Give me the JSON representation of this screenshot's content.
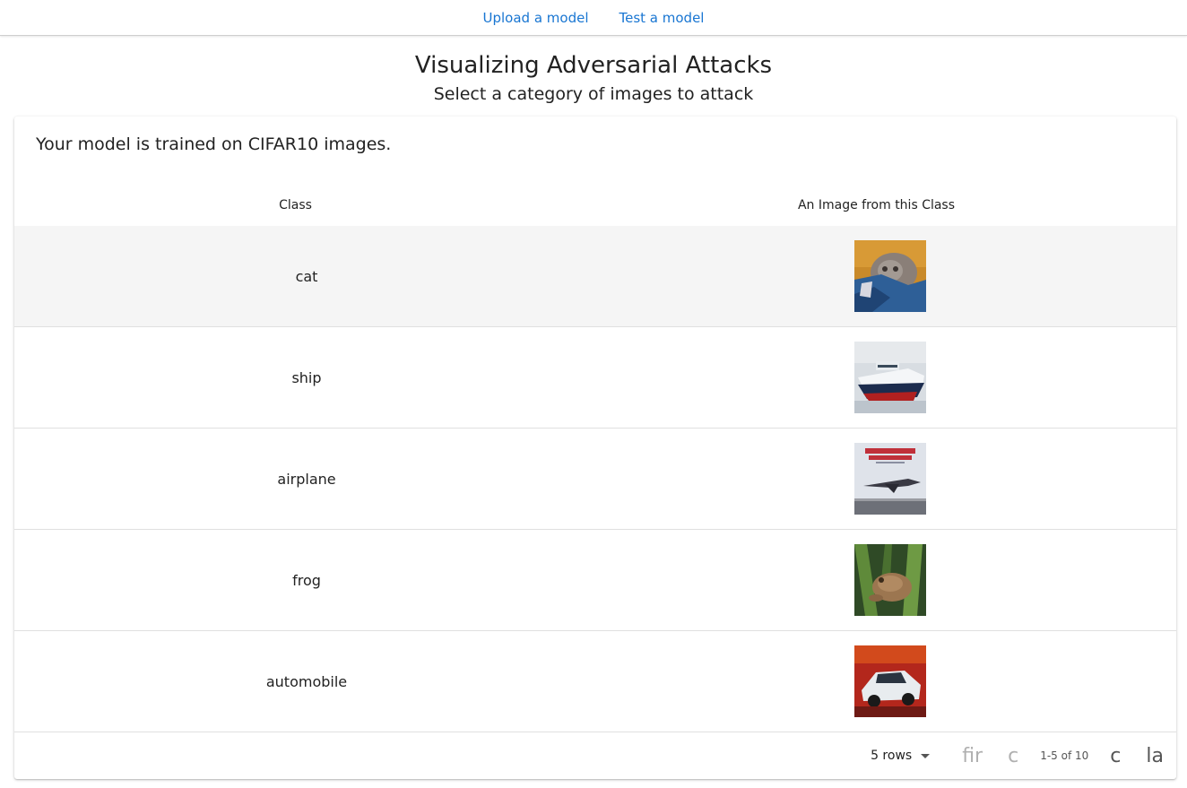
{
  "nav": {
    "links": [
      "Upload a model",
      "Test a model"
    ]
  },
  "page": {
    "title": "Visualizing Adversarial Attacks",
    "subtitle": "Select a category of images to attack"
  },
  "card": {
    "heading": "Your model is trained on CIFAR10 images.",
    "columns": [
      "Class",
      "An Image from this Class"
    ],
    "rows": [
      {
        "class": "cat",
        "image_icon": "cat-image"
      },
      {
        "class": "ship",
        "image_icon": "ship-image"
      },
      {
        "class": "airplane",
        "image_icon": "airplane-image"
      },
      {
        "class": "frog",
        "image_icon": "frog-image"
      },
      {
        "class": "automobile",
        "image_icon": "automobile-image"
      }
    ],
    "highlighted_row": 0
  },
  "pagination": {
    "rows_per_page": "5 rows",
    "first_label": "fir",
    "prev_label": "c",
    "range": "1-5 of 10",
    "next_label": "c",
    "last_label": "la"
  },
  "colors": {
    "link": "#1976d2",
    "highlight_row": "#f5f5f5"
  }
}
